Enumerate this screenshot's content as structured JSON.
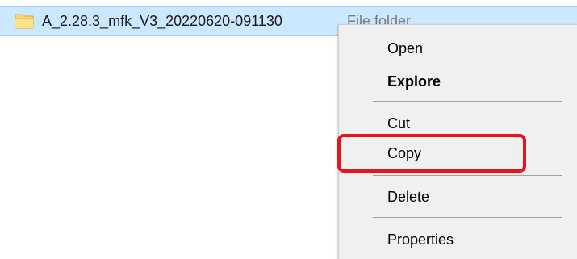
{
  "file": {
    "name": "A_2.28.3_mfk_V3_20220620-091130",
    "type": "File folder",
    "icon": "folder-icon"
  },
  "menu": {
    "items": [
      {
        "label": "Open",
        "bold": false
      },
      {
        "label": "Explore",
        "bold": true
      },
      {
        "label": "Cut",
        "bold": false
      },
      {
        "label": "Copy",
        "bold": false
      },
      {
        "label": "Delete",
        "bold": false
      },
      {
        "label": "Properties",
        "bold": false
      }
    ]
  },
  "annotation": {
    "target": "Copy",
    "color": "#e8141c"
  },
  "colors": {
    "selection": "#cce8ff",
    "menu_background": "#f0f0f0"
  }
}
